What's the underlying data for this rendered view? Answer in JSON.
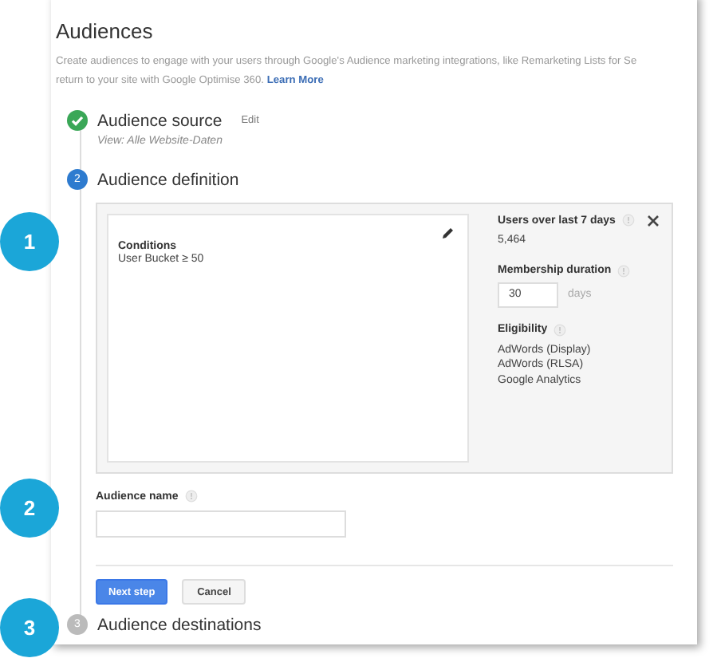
{
  "page": {
    "title": "Audiences",
    "description": {
      "line_1": "Create audiences to engage with your users through Google's Audience marketing integrations, like Remarketing Lists for Se",
      "line_2": "return to your site with Google Optimise 360.",
      "link": "Learn More"
    }
  },
  "steps": [
    {
      "kind": "done",
      "title": "Audience source",
      "action": "Edit",
      "view": "View: Alle Website-Daten"
    },
    {
      "kind": "current",
      "number": "2",
      "title": "Audience definition"
    },
    {
      "kind": "pending",
      "number": "3",
      "title": "Audience destinations"
    }
  ],
  "definition": {
    "conditions_heading": "Conditions",
    "condition": "User Bucket ≥ 50",
    "users_label": "Users over last 7 days",
    "users_value": "5,464",
    "duration_label": "Membership duration",
    "duration_value": "30",
    "duration_unit": "days",
    "eligibility_label": "Eligibility",
    "eligibility": [
      "AdWords (Display)",
      "AdWords (RLSA)",
      "Google Analytics"
    ]
  },
  "audience_name": {
    "label": "Audience name"
  },
  "buttons": [
    {
      "kind": "primary",
      "label": "Next step"
    },
    {
      "kind": "secondary",
      "label": "Cancel"
    }
  ],
  "callouts": [
    "1",
    "2",
    "3"
  ]
}
